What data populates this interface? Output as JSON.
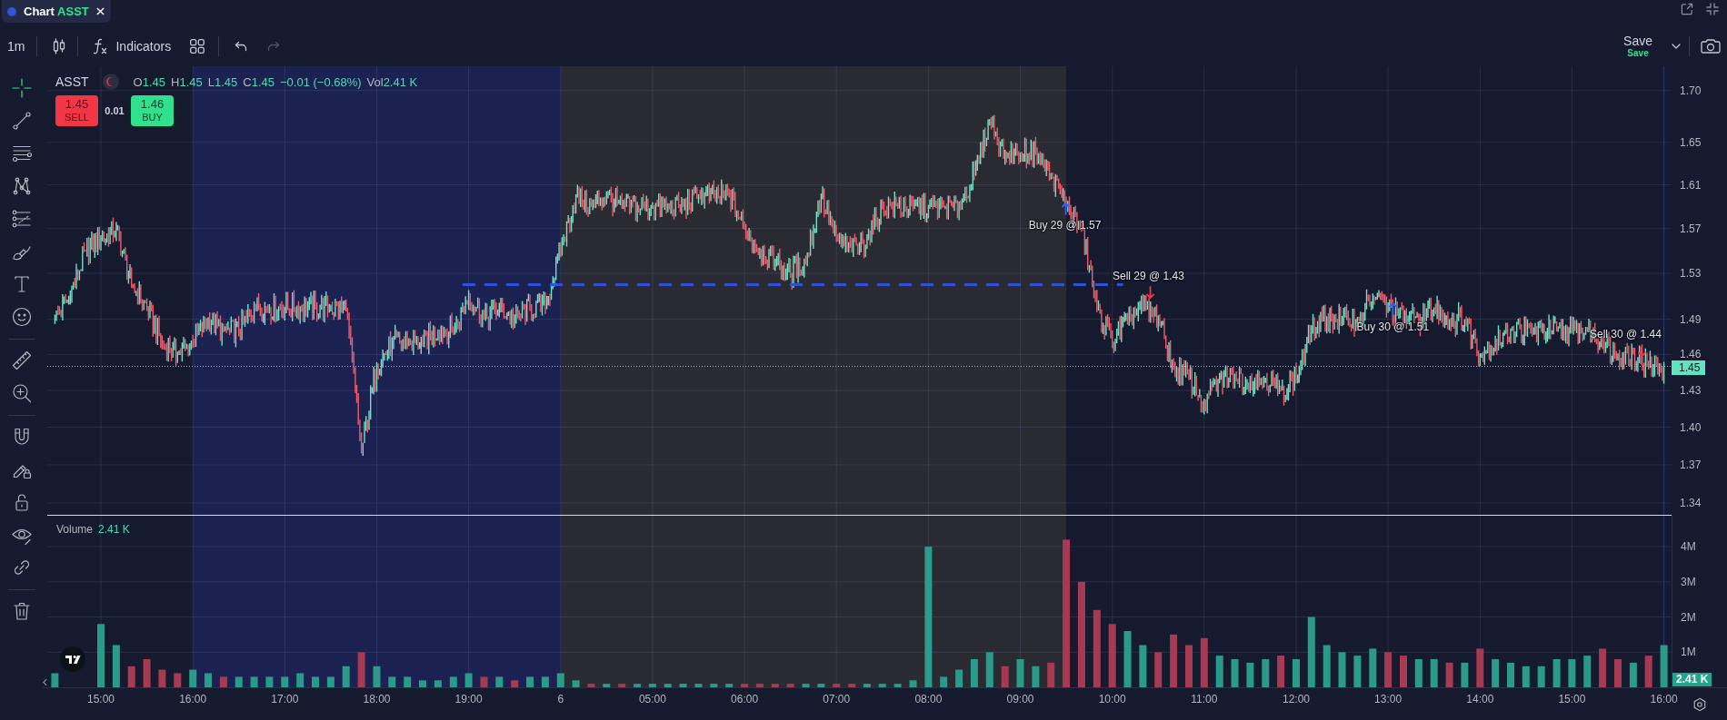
{
  "tab": {
    "title": "Chart",
    "symbol": "ASST"
  },
  "toolbar": {
    "interval": "1m",
    "indicators": "Indicators",
    "undo": {
      "disabled": false
    },
    "redo": {
      "disabled": true
    },
    "save": {
      "label": "Save",
      "status": "Save"
    }
  },
  "drawing_tools": [
    {
      "tools": [
        {
          "kind": "crosshair",
          "selected": true
        },
        {
          "kind": "line",
          "selected": false
        },
        {
          "kind": "levels",
          "selected": false
        },
        {
          "kind": "pattern",
          "selected": false
        },
        {
          "kind": "forecast",
          "selected": false
        },
        {
          "kind": "brush",
          "selected": false
        },
        {
          "kind": "text",
          "selected": false
        },
        {
          "kind": "emoji",
          "selected": false
        }
      ]
    },
    {
      "tools": [
        {
          "kind": "ruler",
          "selected": false
        },
        {
          "kind": "zoom",
          "selected": false
        }
      ]
    },
    {
      "tools": [
        {
          "kind": "magnet",
          "selected": false
        },
        {
          "kind": "drawlock",
          "selected": false
        },
        {
          "kind": "lock",
          "selected": false
        },
        {
          "kind": "eye",
          "selected": false
        },
        {
          "kind": "link",
          "selected": false
        }
      ]
    },
    {
      "tools": [
        {
          "kind": "trash",
          "selected": false
        }
      ]
    }
  ],
  "price_pane": {
    "legend": {
      "symbol": "ASST",
      "values": [
        {
          "label": "O",
          "value": "1.45"
        },
        {
          "label": "H",
          "value": "1.45"
        },
        {
          "label": "L",
          "value": "1.45"
        },
        {
          "label": "C",
          "value": "1.45"
        }
      ],
      "change": "−0.01 (−0.68%)",
      "volume": {
        "label": "Vol",
        "value": "2.41 K"
      }
    },
    "order_buttons": [
      {
        "kind": "sell",
        "price": "1.45",
        "label": "SELL"
      },
      {
        "kind": "buy",
        "price": "1.46",
        "label": "BUY"
      }
    ],
    "spread": "0.01",
    "trades": [
      {
        "kind": "buy",
        "label": "Buy 29 @ 1.57"
      },
      {
        "kind": "sell",
        "label": "Sell 29 @ 1.43"
      },
      {
        "kind": "buy",
        "label": "Buy 30 @ 1.51"
      },
      {
        "kind": "sell",
        "label": "Sell 30 @ 1.44"
      }
    ],
    "price_tag": "1.45",
    "price_axis": {
      "labels": [
        "1.70",
        "1.65",
        "1.61",
        "1.57",
        "1.53",
        "1.49",
        "1.46",
        "1.43",
        "1.40",
        "1.37",
        "1.34"
      ]
    }
  },
  "volume_pane": {
    "title": "Volume",
    "value": "2.41 K",
    "tag": "2.41 K",
    "chart_data": {
      "type": "bar",
      "values": [
        400000,
        null,
        null,
        1800000,
        1200000,
        600000,
        800000,
        500000,
        400000,
        500000,
        400000,
        300000,
        300000,
        300000,
        300000,
        300000,
        400000,
        300000,
        300000,
        600000,
        1000000,
        600000,
        300000,
        300000,
        200000,
        200000,
        300000,
        400000,
        300000,
        300000,
        200000,
        300000,
        300000,
        400000,
        200000,
        100000,
        100000,
        100000,
        100000,
        100000,
        100000,
        100000,
        100000,
        100000,
        100000,
        100000,
        100000,
        100000,
        100000,
        100000,
        100000,
        100000,
        100000,
        100000,
        100000,
        100000,
        200000,
        4000000,
        300000,
        500000,
        800000,
        1000000,
        600000,
        800000,
        600000,
        700000,
        4200000,
        3000000,
        2200000,
        1800000,
        1600000,
        1200000,
        1000000,
        1500000,
        1200000,
        1400000,
        900000,
        800000,
        700000,
        800000,
        900000,
        800000,
        2000000,
        1200000,
        1000000,
        900000,
        1100000,
        1000000,
        900000,
        800000,
        800000,
        700000,
        700000,
        1100000,
        800000,
        700000,
        600000,
        600000,
        800000,
        800000,
        900000,
        1100000,
        800000,
        700000,
        900000,
        1200000
      ],
      "ylim": [
        0,
        4880000
      ],
      "yticks": [
        {
          "value": 4000000,
          "label": "4M"
        },
        {
          "value": 3000000,
          "label": "3M"
        },
        {
          "value": 2000000,
          "label": "2M"
        },
        {
          "value": 1000000,
          "label": "1M"
        }
      ],
      "grid": true
    }
  },
  "time_axis": {
    "labels": [
      "15:00",
      "16:00",
      "17:00",
      "18:00",
      "19:00",
      "6",
      "05:00",
      "06:00",
      "07:00",
      "08:00",
      "09:00",
      "10:00",
      "11:00",
      "12:00",
      "13:00",
      "14:00",
      "15:00",
      "16:00"
    ]
  }
}
